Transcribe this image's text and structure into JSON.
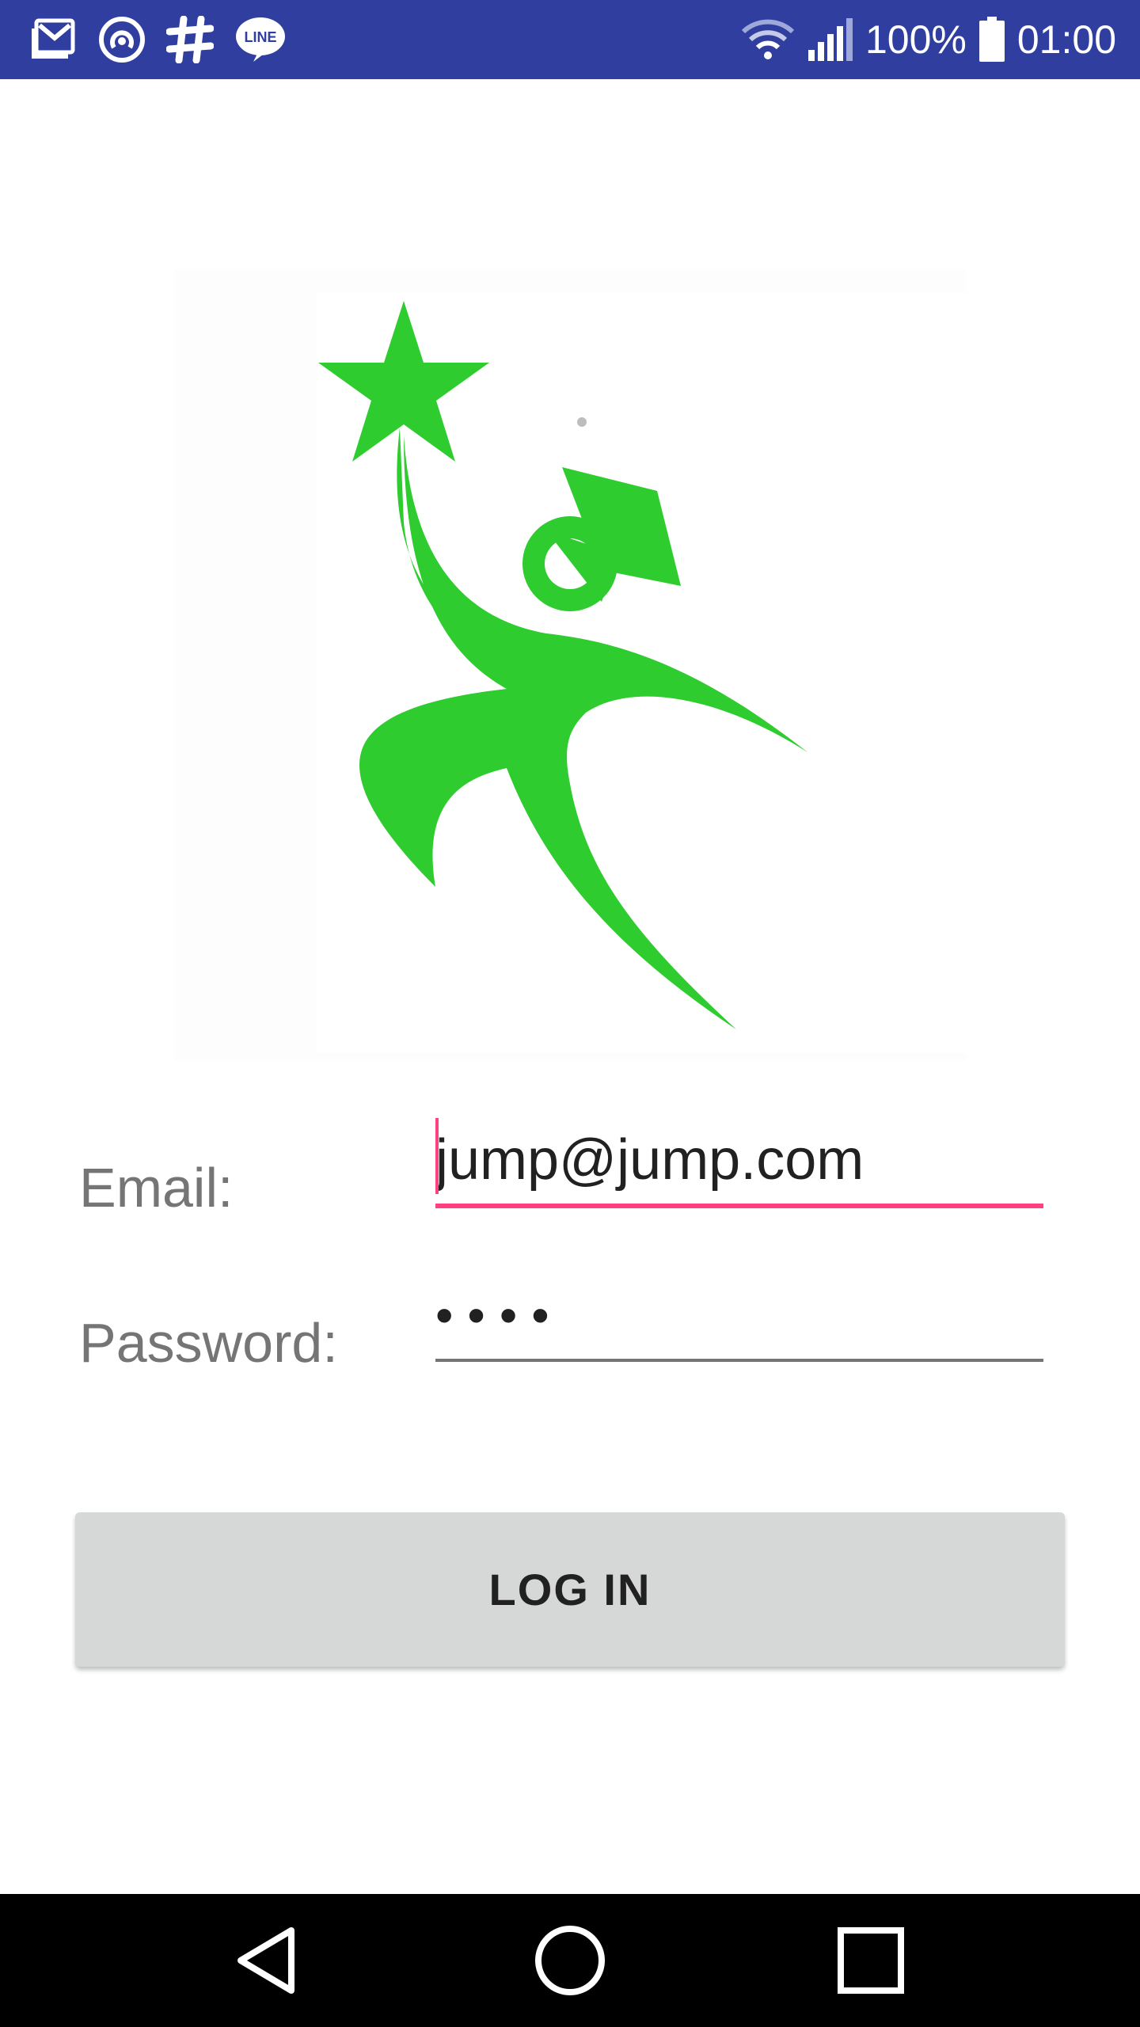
{
  "status_bar": {
    "battery": "100%",
    "time": "01:00",
    "left_icons": [
      "gmail-icon",
      "airdroid-icon",
      "slack-icon",
      "line-icon"
    ],
    "right_icons": [
      "wifi-icon",
      "signal-icon",
      "battery-icon"
    ],
    "line_badge": "LINE",
    "background_color": "#303f9f"
  },
  "logo": {
    "icon": "jump-logo-icon",
    "color": "#2ecc2e"
  },
  "form": {
    "email_label": "Email:",
    "email_value": "jump@jump.com",
    "password_label": "Password:",
    "password_value": "jump",
    "accent_color": "#ff4081"
  },
  "login_button": {
    "label": "LOG IN"
  },
  "nav_bar": {
    "back_icon": "back-triangle-icon",
    "home_icon": "home-circle-icon",
    "recents_icon": "recents-square-icon"
  }
}
